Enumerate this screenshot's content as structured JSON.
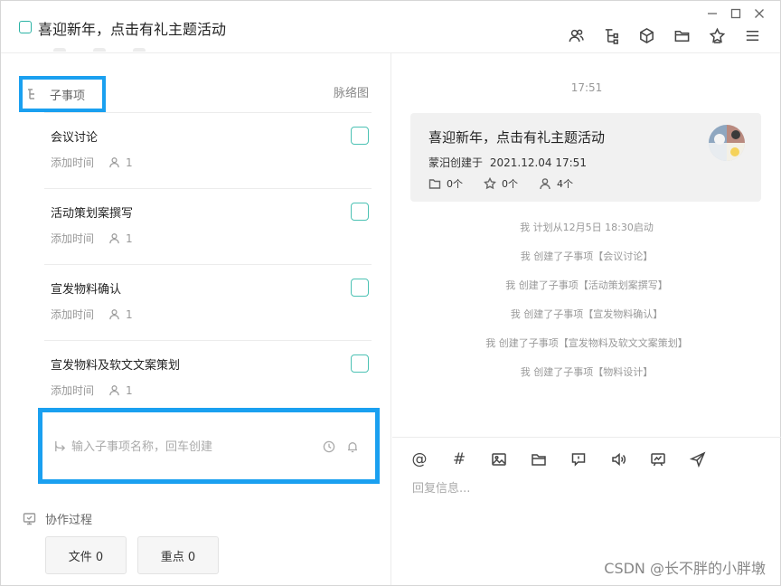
{
  "window": {
    "title": "喜迎新年，点击有礼主题活动",
    "controls": [
      "minimize-icon",
      "maximize-icon",
      "close-icon"
    ]
  },
  "toolbar": {
    "icons": [
      "members-icon",
      "hierarchy-icon",
      "cube-icon",
      "folder-icon",
      "star-icon",
      "menu-icon"
    ]
  },
  "left": {
    "subtasks_header": "子事项",
    "mindmap_link": "脉络图",
    "subtasks": [
      {
        "name": "会议讨论",
        "time_label": "添加时间",
        "assignees": "1"
      },
      {
        "name": "活动策划案撰写",
        "time_label": "添加时间",
        "assignees": "1"
      },
      {
        "name": "宣发物料确认",
        "time_label": "添加时间",
        "assignees": "1"
      },
      {
        "name": "宣发物料及软文文案策划",
        "time_label": "添加时间",
        "assignees": "1"
      }
    ],
    "new_subtask_placeholder": "输入子事项名称，回车创建",
    "process_label": "协作过程",
    "chips": {
      "files": "文件 0",
      "highlights": "重点 0"
    }
  },
  "right": {
    "time": "17:51",
    "card": {
      "title": "喜迎新年，点击有礼主题活动",
      "creator_prefix": "蒙汨创建于",
      "created_at": "2021.12.04 17:51",
      "files": "0个",
      "stars": "0个",
      "members": "4个"
    },
    "logs": [
      "我 计划从12月5日 18:30启动",
      "我 创建了子事项【会议讨论】",
      "我 创建了子事项【活动策划案撰写】",
      "我 创建了子事项【宣发物料确认】",
      "我 创建了子事项【宣发物料及软文文案策划】",
      "我 创建了子事项【物料设计】"
    ],
    "composer_tools": [
      "mention-icon",
      "hashtag-icon",
      "image-icon",
      "folder-icon",
      "feedback-icon",
      "voice-icon",
      "whiteboard-icon",
      "send-icon"
    ],
    "composer_mention": "@",
    "composer_hash": "#",
    "reply_placeholder": "回复信息..."
  },
  "watermark": "CSDN @长不胖的小胖墩",
  "colors": {
    "accent": "#2bb3a5",
    "highlight_box": "#1aa0f0",
    "card_bg": "#f1f1f1"
  }
}
